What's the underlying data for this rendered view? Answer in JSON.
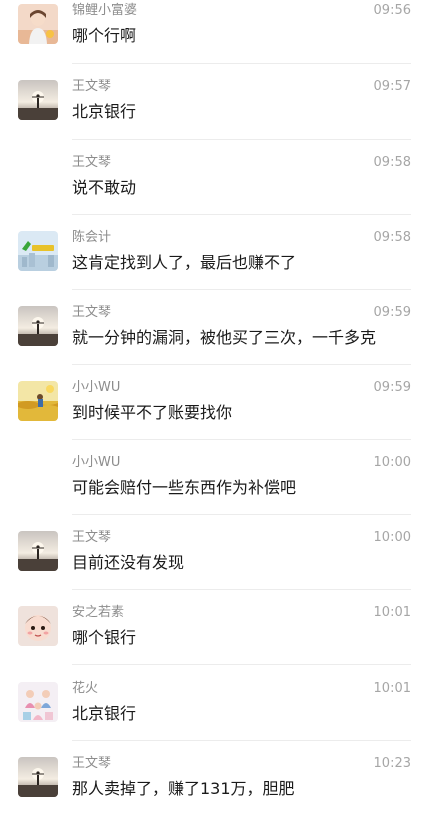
{
  "messages": [
    {
      "sender": "锦鲤小富婆",
      "time": "09:56",
      "text": "哪个行啊",
      "avatar": "girl-avatar"
    },
    {
      "sender": "王文琴",
      "time": "09:57",
      "text": "北京银行",
      "avatar": "sunset-avatar"
    },
    {
      "sender": "王文琴",
      "time": "09:58",
      "text": "说不敢动",
      "avatar": ""
    },
    {
      "sender": "陈会计",
      "time": "09:58",
      "text": "这肯定找到人了，最后也赚不了",
      "avatar": "accounting-logo-avatar"
    },
    {
      "sender": "王文琴",
      "time": "09:59",
      "text": "就一分钟的漏洞，被他买了三次，一千多克",
      "avatar": "sunset-avatar"
    },
    {
      "sender": "小小WU",
      "time": "09:59",
      "text": "到时候平不了账要找你",
      "avatar": "wheat-field-avatar"
    },
    {
      "sender": "小小WU",
      "time": "10:00",
      "text": "可能会赔付一些东西作为补偿吧",
      "avatar": ""
    },
    {
      "sender": "王文琴",
      "time": "10:00",
      "text": "目前还没有发现",
      "avatar": "sunset-avatar"
    },
    {
      "sender": "安之若素",
      "time": "10:01",
      "text": "哪个银行",
      "avatar": "baby-avatar"
    },
    {
      "sender": "花火",
      "time": "10:01",
      "text": "北京银行",
      "avatar": "family-avatar"
    },
    {
      "sender": "王文琴",
      "time": "10:23",
      "text": "那人卖掉了，赚了131万，胆肥",
      "avatar": "sunset-avatar"
    }
  ]
}
